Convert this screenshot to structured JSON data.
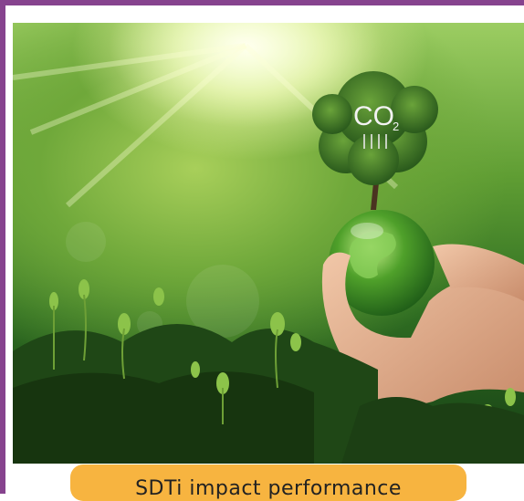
{
  "image": {
    "subject": "Hands holding a glass globe with a tree growing on top, grass and sunlight",
    "tree_label": "CO2"
  },
  "caption": {
    "text": "SDTi impact performance"
  },
  "colors": {
    "border": "#86438e",
    "caption_background": "#f7b440"
  }
}
